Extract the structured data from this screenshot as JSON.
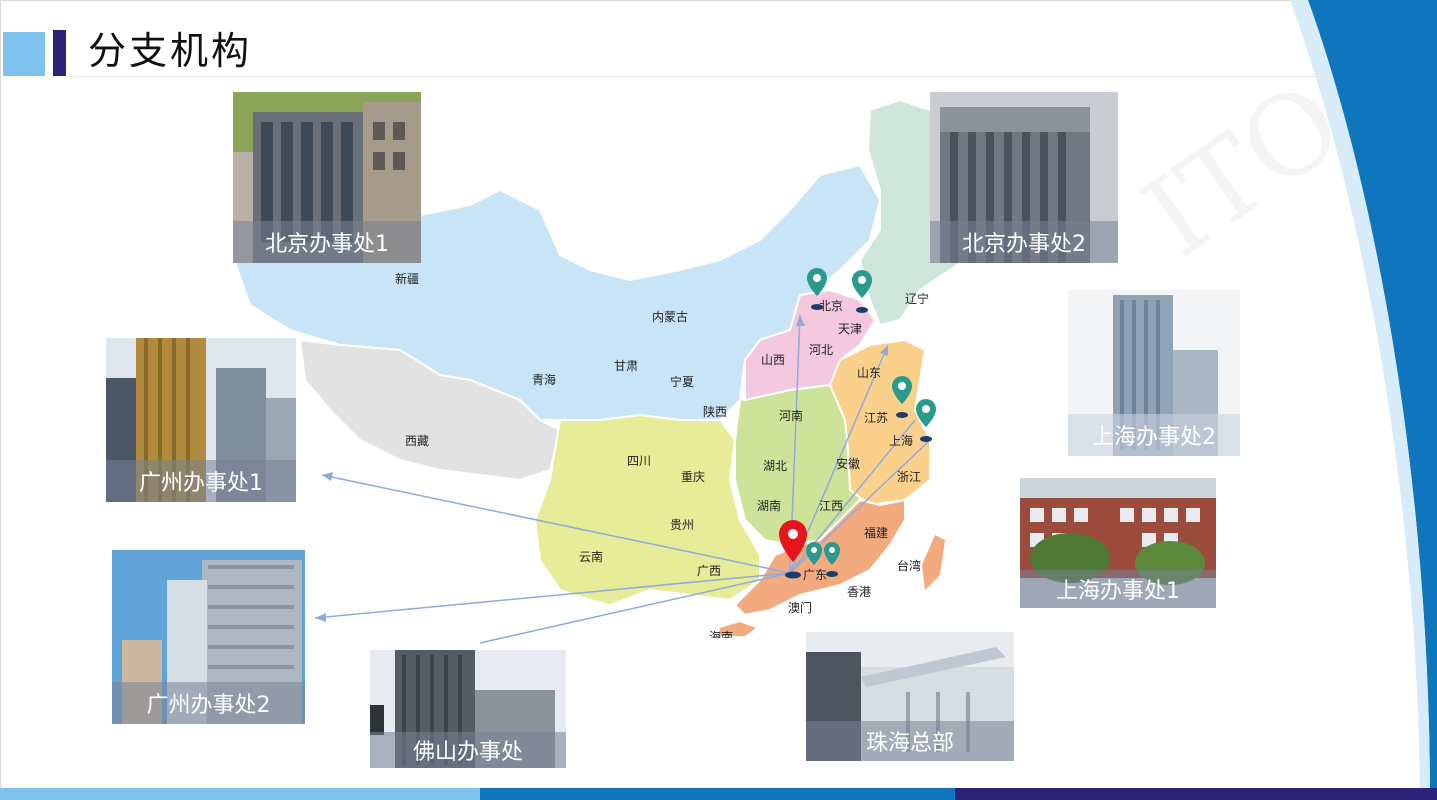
{
  "slide": {
    "title": "分支机构"
  },
  "provinces": [
    {
      "key": "xinjiang",
      "label": "新疆"
    },
    {
      "key": "neimenggu",
      "label": "内蒙古"
    },
    {
      "key": "qinghai",
      "label": "青海"
    },
    {
      "key": "gansu",
      "label": "甘肃"
    },
    {
      "key": "ningxia",
      "label": "宁夏"
    },
    {
      "key": "shaanxi",
      "label": "陕西"
    },
    {
      "key": "xizang",
      "label": "西藏"
    },
    {
      "key": "sichuan",
      "label": "四川"
    },
    {
      "key": "chongqing",
      "label": "重庆"
    },
    {
      "key": "guizhou",
      "label": "贵州"
    },
    {
      "key": "yunnan",
      "label": "云南"
    },
    {
      "key": "guangxi",
      "label": "广西"
    },
    {
      "key": "shanxi",
      "label": "山西"
    },
    {
      "key": "hebei",
      "label": "河北"
    },
    {
      "key": "beijing",
      "label": "北京"
    },
    {
      "key": "tianjin",
      "label": "天津"
    },
    {
      "key": "liaoning",
      "label": "辽宁"
    },
    {
      "key": "shandong",
      "label": "山东"
    },
    {
      "key": "henan",
      "label": "河南"
    },
    {
      "key": "jiangsu",
      "label": "江苏"
    },
    {
      "key": "shanghai",
      "label": "上海"
    },
    {
      "key": "anhui",
      "label": "安徽"
    },
    {
      "key": "hubei",
      "label": "湖北"
    },
    {
      "key": "zhejiang",
      "label": "浙江"
    },
    {
      "key": "hunan",
      "label": "湖南"
    },
    {
      "key": "jiangxi",
      "label": "江西"
    },
    {
      "key": "fujian",
      "label": "福建"
    },
    {
      "key": "taiwan",
      "label": "台湾"
    },
    {
      "key": "guangdong",
      "label": "广东"
    },
    {
      "key": "xianggang",
      "label": "香港"
    },
    {
      "key": "aomen",
      "label": "澳门"
    },
    {
      "key": "hainan",
      "label": "海南"
    }
  ],
  "offices": [
    {
      "key": "bj1",
      "caption": "北京办事处1"
    },
    {
      "key": "bj2",
      "caption": "北京办事处2"
    },
    {
      "key": "sh2",
      "caption": "上海办事处2"
    },
    {
      "key": "sh1",
      "caption": "上海办事处1"
    },
    {
      "key": "gz1",
      "caption": "广州办事处1"
    },
    {
      "key": "gz2",
      "caption": "广州办事处2"
    },
    {
      "key": "fs",
      "caption": "佛山办事处"
    },
    {
      "key": "zh",
      "caption": "珠海总部"
    }
  ],
  "colors": {
    "title_square": "#7dc3ee",
    "title_bar": "#2b2378",
    "headquarters_pin": "#e8141c",
    "office_pin": "#2a9a8c",
    "arrow": "#8faadc",
    "right_band": "#0f75bc"
  }
}
